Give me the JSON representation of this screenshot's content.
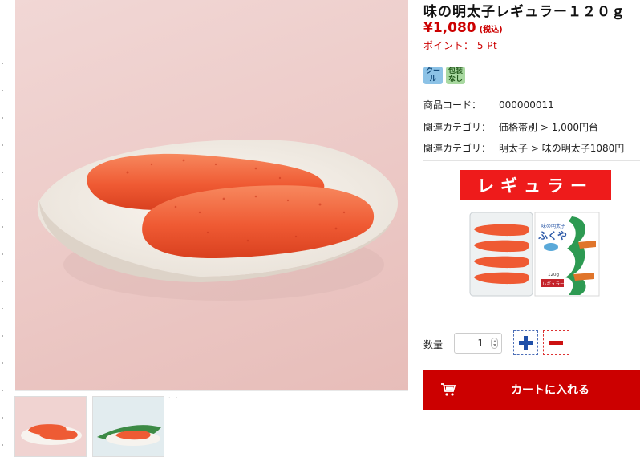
{
  "product": {
    "title": "味の明太子レギュラー１２０ｇ",
    "price": "¥1,080",
    "tax_note": "(税込)",
    "points": "ポイント： 5 Pt",
    "tags": [
      "クール",
      "包装なし"
    ],
    "code_label": "商品コード：",
    "code_value": "000000011",
    "category1_label": "関連カテゴリ：",
    "category1_value": "価格帯別 > 1,000円台",
    "category2_label": "関連カテゴリ：",
    "category2_value": "明太子 > 味の明太子1080円",
    "banner": "レギュラー",
    "package_brand": "ふくや",
    "package_size": "120g",
    "package_type": "レギュラー"
  },
  "quantity": {
    "label": "数量",
    "value": "1"
  },
  "cart": {
    "button_label": "カートに入れる"
  },
  "icons": {
    "plus": "plus-icon",
    "minus": "minus-icon",
    "cart": "cart-icon"
  },
  "colors": {
    "accent": "#cc0000",
    "banner": "#ee1b1b",
    "plus": "#1f4fa8"
  }
}
